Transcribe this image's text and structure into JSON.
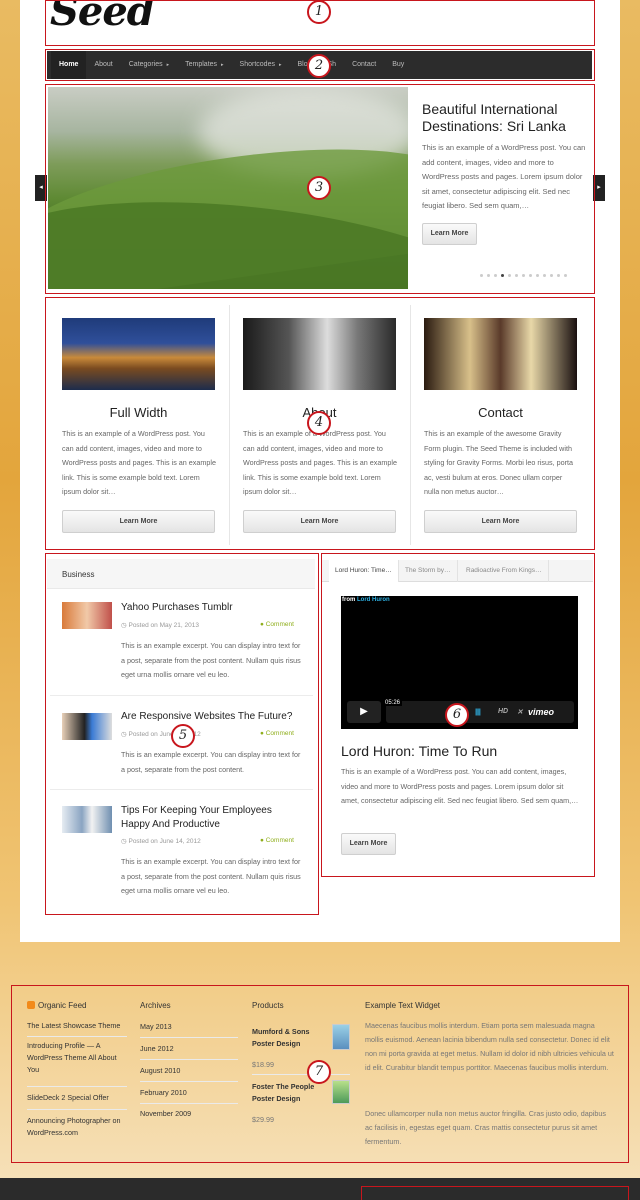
{
  "header": {
    "logo": "Seed"
  },
  "nav": {
    "items": [
      {
        "label": "Home"
      },
      {
        "label": "About"
      },
      {
        "label": "Categories",
        "arrow": "▸"
      },
      {
        "label": "Templates",
        "arrow": "▸"
      },
      {
        "label": "Shortcodes",
        "arrow": "▸"
      },
      {
        "label": "Blog"
      },
      {
        "label": "Sh"
      },
      {
        "label": "Contact"
      },
      {
        "label": "Buy"
      }
    ]
  },
  "slider": {
    "title": "Beautiful International Destinations: Sri Lanka",
    "text": "This is an example of a WordPress post. You can add content, images, video and more to WordPress posts and pages. Lorem ipsum dolor sit amet, consectetur adipiscing elit. Sed nec feugiat libero. Sed sem quam,…",
    "button": "Learn More",
    "prev": "◂",
    "next": "▸",
    "active_slide": 4,
    "slide_count": 13
  },
  "features": [
    {
      "title": "Full Width",
      "text": "This is an example of a WordPress post. You can add content, images, video and more to WordPress posts and pages. This is an example link. This is some example bold text. Lorem ipsum dolor sit…",
      "button": "Learn More"
    },
    {
      "title": "About",
      "text": "This is an example of a WordPress post. You can add content, images, video and more to WordPress posts and pages. This is an example link. This is some example bold text. Lorem ipsum dolor sit…",
      "button": "Learn More"
    },
    {
      "title": "Contact",
      "text": "This is an example of the awesome Gravity Form plugin. The Seed Theme is included with styling for Gravity Forms. Morbi leo risus, porta ac, vesti bulum at eros. Donec ullam corper nulla non metus auctor…",
      "button": "Learn More"
    }
  ],
  "business": {
    "title": "Business",
    "posts": [
      {
        "title": "Yahoo Purchases Tumblr",
        "meta": "Posted on May 21, 2013",
        "comment": "Comment",
        "text": "This is an example excerpt. You can display intro text for a post, separate from the post content. Nullam quis risus eget urna mollis ornare vel eu leo."
      },
      {
        "title": "Are Responsive Websites The Future?",
        "meta": "Posted on June 15, 2012",
        "comment": "Comment",
        "text": "This is an example excerpt. You can display intro text for a post, separate from the post content."
      },
      {
        "title": "Tips For Keeping Your Employees Happy And Productive",
        "meta": "Posted on June 14, 2012",
        "comment": "Comment",
        "text": "This is an example excerpt. You can display intro text for a post, separate from the post content. Nullam quis risus eget urna mollis ornare vel eu leo."
      }
    ]
  },
  "video": {
    "tabs": [
      "Lord Huron: Time…",
      "The Storm by…",
      "Radioactive From Kings…"
    ],
    "from_prefix": "from",
    "from_name": "Lord Huron",
    "time": "05:26",
    "hd": "HD",
    "fullscreen": "✕",
    "bars": "||||||",
    "vimeo": "vimeo",
    "title": "Lord Huron: Time To Run",
    "text": "This is an example of a WordPress post. You can add content, images, video and more to WordPress posts and pages. Lorem ipsum dolor sit amet, consectetur adipiscing elit. Sed nec feugiat libero. Sed sem quam,…",
    "button": "Learn More"
  },
  "footer": {
    "feed": {
      "title": "Organic Feed",
      "items": [
        "The Latest Showcase Theme",
        "Introducing Profile — A WordPress Theme All About You",
        "SlideDeck 2 Special Offer",
        "Announcing Photographer on WordPress.com"
      ]
    },
    "archives": {
      "title": "Archives",
      "items": [
        "May 2013",
        "June 2012",
        "August 2010",
        "February 2010",
        "November 2009"
      ]
    },
    "products": {
      "title": "Products",
      "items": [
        {
          "name": "Mumford & Sons Poster Design",
          "price": "$18.99"
        },
        {
          "name": "Foster The People Poster Design",
          "price": "$29.99"
        }
      ]
    },
    "widget": {
      "title": "Example Text Widget",
      "p1": "Maecenas faucibus mollis interdum. Etiam porta sem malesuada magna mollis euismod. Aenean lacinia bibendum nulla sed consectetur. Donec id elit non mi porta gravida at eget metus. Nullam id dolor id nibh ultricies vehicula ut id elit. Curabitur blandit tempus porttitor. Maecenas faucibus mollis interdum.",
      "p2": "Donec ullamcorper nulla non metus auctor fringilla. Cras justo odio, dapibus ac facilisis in, egestas eget quam. Cras mattis consectetur purus sit amet fermentum."
    }
  },
  "markers": [
    "1",
    "2",
    "3",
    "4",
    "5",
    "6",
    "7"
  ],
  "colors": {
    "annotation": "#c8161d",
    "nav_bg": "#2c2c2c",
    "comment_link": "#8fae1b",
    "vimeo_blue": "#2eb3e6"
  }
}
